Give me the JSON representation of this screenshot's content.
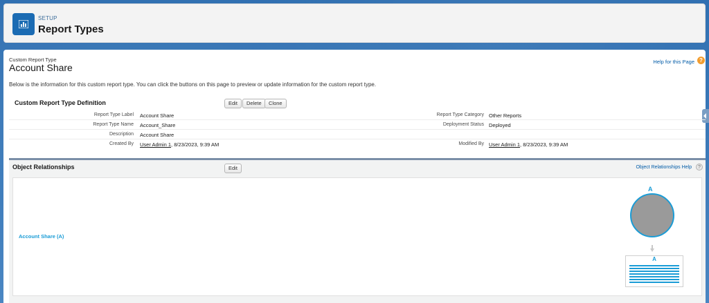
{
  "header": {
    "eyebrow": "SETUP",
    "title": "Report Types",
    "icon": "report-types-icon"
  },
  "page": {
    "eyebrow": "Custom Report Type",
    "title": "Account Share",
    "help_link": "Help for this Page",
    "intro": "Below is the information for this custom report type. You can click the buttons on this page to preview or update information for the custom report type."
  },
  "definition": {
    "title": "Custom Report Type Definition",
    "buttons": {
      "edit": "Edit",
      "delete": "Delete",
      "clone": "Clone"
    },
    "fields": {
      "report_type_label": {
        "label": "Report Type Label",
        "value": "Account Share"
      },
      "report_type_name": {
        "label": "Report Type Name",
        "value": "Account_Share"
      },
      "description": {
        "label": "Description",
        "value": "Account Share"
      },
      "created_by": {
        "label": "Created By",
        "user": "User Admin 1",
        "date": ", 8/23/2023, 9:39 AM"
      },
      "report_type_category": {
        "label": "Report Type Category",
        "value": "Other Reports"
      },
      "deployment_status": {
        "label": "Deployment Status",
        "value": "Deployed"
      },
      "modified_by": {
        "label": "Modified By",
        "user": "User Admin 1",
        "date": ", 8/23/2023, 9:39 AM"
      }
    }
  },
  "relationships": {
    "title": "Object Relationships",
    "edit_button": "Edit",
    "help_link": "Object Relationships Help",
    "object_link": "Account Share (A)",
    "diagram": {
      "top_label": "A",
      "box_label": "A"
    }
  },
  "colors": {
    "accent": "#1a9cd6",
    "link": "#015ba7",
    "brand": "#1b6bb3"
  }
}
